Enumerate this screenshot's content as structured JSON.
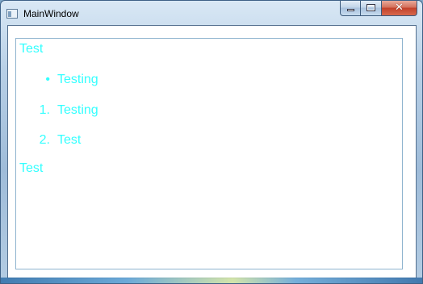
{
  "window": {
    "title": "MainWindow",
    "icon": "window-app-icon",
    "caption_buttons": {
      "minimize_icon": "minimize-icon",
      "maximize_icon": "maximize-icon",
      "close_icon": "close-icon",
      "close_glyph": "✕"
    }
  },
  "document": {
    "text_color": "#33ffff",
    "paragraph_1": "Test",
    "bullet_list": [
      {
        "marker": "•",
        "text": "Testing"
      }
    ],
    "numbered_list": [
      {
        "marker": "1.",
        "text": "Testing"
      },
      {
        "marker": "2.",
        "text": "Test"
      }
    ],
    "paragraph_2": "Test"
  }
}
